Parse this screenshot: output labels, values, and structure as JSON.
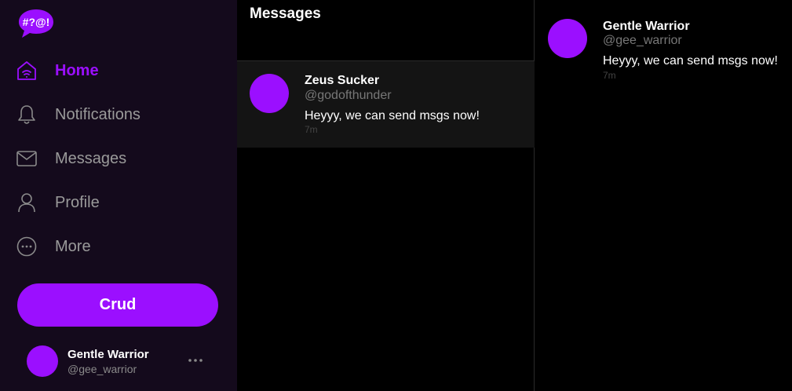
{
  "app": {
    "logo_text": "#?@!",
    "accent": "#9b0fff"
  },
  "sidebar": {
    "items": [
      {
        "label": "Home",
        "icon": "home-icon",
        "active": true
      },
      {
        "label": "Notifications",
        "icon": "bell-icon"
      },
      {
        "label": "Messages",
        "icon": "envelope-icon"
      },
      {
        "label": "Profile",
        "icon": "user-icon"
      },
      {
        "label": "More",
        "icon": "more-circle-icon"
      }
    ],
    "crud_label": "Crud",
    "user": {
      "name": "Gentle Warrior",
      "handle": "@gee_warrior"
    }
  },
  "messages": {
    "title": "Messages",
    "conversations": [
      {
        "name": "Zeus Sucker",
        "handle": "@godofthunder",
        "text": "Heyyy, we can send msgs now!",
        "time": "7m"
      }
    ]
  },
  "detail": {
    "name": "Gentle Warrior",
    "handle": "@gee_warrior",
    "text": "Heyyy, we can send msgs now!",
    "time": "7m"
  }
}
